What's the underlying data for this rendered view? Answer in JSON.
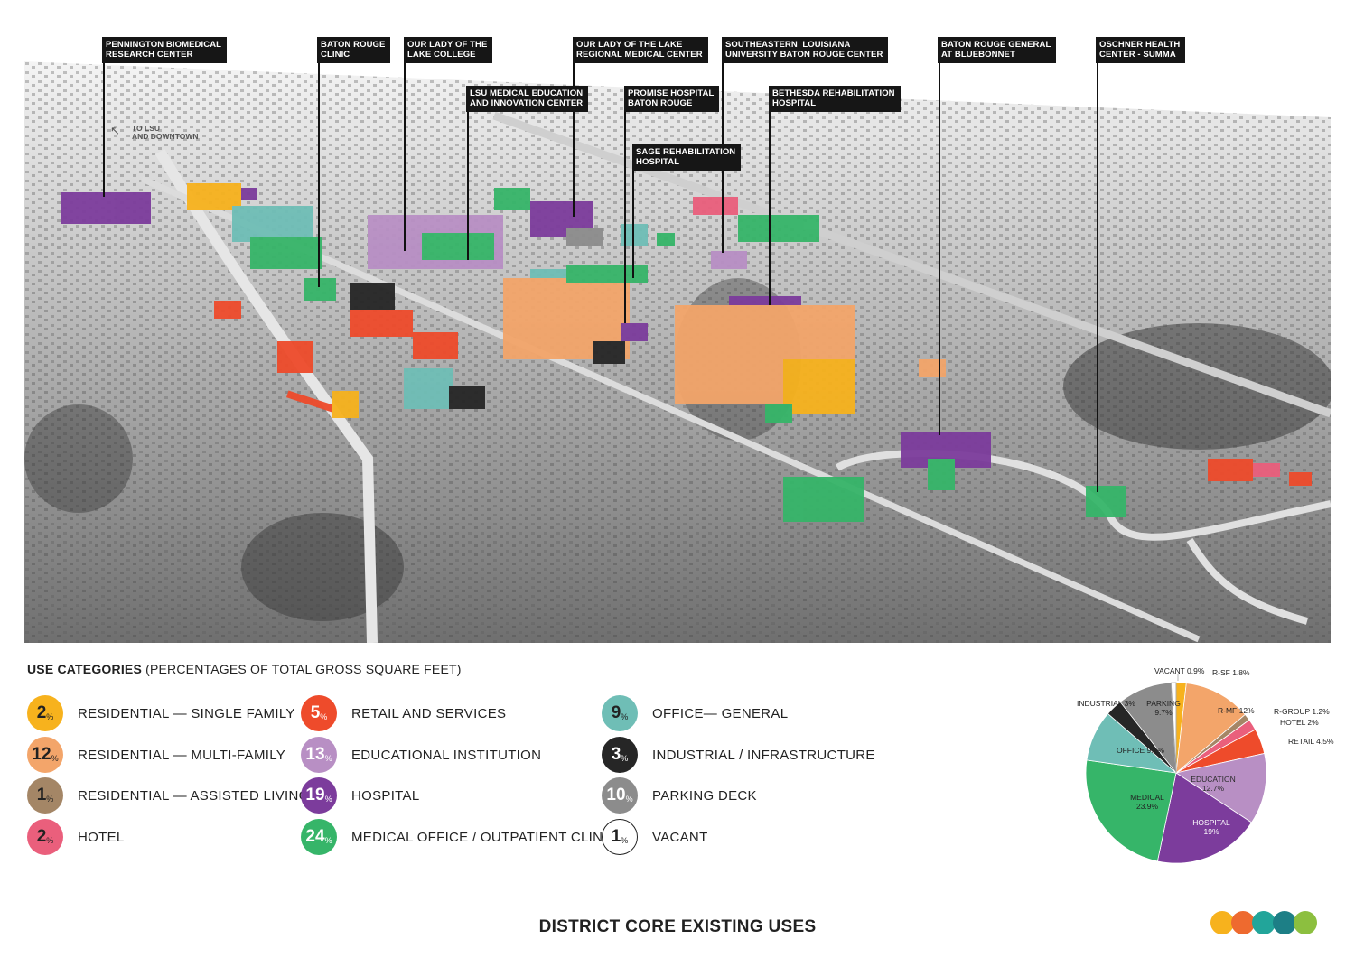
{
  "title": "DISTRICT CORE EXISTING USES",
  "map": {
    "annotation": "TO LSU\nAND DOWNTOWN",
    "callouts": [
      {
        "text": "PENNINGTON BIOMEDICAL\nRESEARCH CENTER"
      },
      {
        "text": "BATON ROUGE\nCLINIC"
      },
      {
        "text": "OUR LADY OF THE\nLAKE COLLEGE"
      },
      {
        "text": "LSU MEDICAL EDUCATION\nAND INNOVATION CENTER"
      },
      {
        "text": "OUR LADY OF THE LAKE\nREGIONAL MEDICAL CENTER"
      },
      {
        "text": "PROMISE HOSPITAL\nBATON ROUGE"
      },
      {
        "text": "SAGE REHABILITATION\nHOSPITAL"
      },
      {
        "text": "SOUTHEASTERN  LOUISIANA\nUNIVERSITY BATON ROUGE CENTER"
      },
      {
        "text": "BETHESDA REHABILITATION\nHOSPITAL"
      },
      {
        "text": "BATON ROUGE GENERAL\nAT BLUEBONNET"
      },
      {
        "text": "OSCHNER HEALTH\nCENTER - SUMMA"
      }
    ]
  },
  "legend": {
    "title": "USE CATEGORIES",
    "subtitle": "(PERCENTAGES OF TOTAL GROSS SQUARE FEET)",
    "items": [
      {
        "value": "2",
        "unit": "%",
        "label": "RESIDENTIAL — SINGLE FAMILY",
        "color": "#f7b21d",
        "text_color": "#222222"
      },
      {
        "value": "12",
        "unit": "%",
        "label": "RESIDENTIAL — MULTI-FAMILY",
        "color": "#f3a56a",
        "text_color": "#222222"
      },
      {
        "value": "1",
        "unit": "%",
        "label": "RESIDENTIAL — ASSISTED LIVING",
        "color": "#a48666",
        "text_color": "#222222"
      },
      {
        "value": "2",
        "unit": "%",
        "label": "HOTEL",
        "color": "#ea5f7c",
        "text_color": "#222222"
      },
      {
        "value": "5",
        "unit": "%",
        "label": "RETAIL AND SERVICES",
        "color": "#ee4b2b",
        "text_color": "#ffffff"
      },
      {
        "value": "13",
        "unit": "%",
        "label": "EDUCATIONAL INSTITUTION",
        "color": "#b88fc4",
        "text_color": "#ffffff"
      },
      {
        "value": "19",
        "unit": "%",
        "label": "HOSPITAL",
        "color": "#7c3c9c",
        "text_color": "#ffffff"
      },
      {
        "value": "24",
        "unit": "%",
        "label": "MEDICAL OFFICE  /  OUTPATIENT CLINIC",
        "color": "#36b569",
        "text_color": "#ffffff"
      },
      {
        "value": "9",
        "unit": "%",
        "label": "OFFICE— GENERAL",
        "color": "#6fbeb6",
        "text_color": "#222222"
      },
      {
        "value": "3",
        "unit": "%",
        "label": "INDUSTRIAL  /  INFRASTRUCTURE",
        "color": "#262626",
        "text_color": "#ffffff"
      },
      {
        "value": "10",
        "unit": "%",
        "label": "PARKING DECK",
        "color": "#8c8c8c",
        "text_color": "#ffffff"
      },
      {
        "value": "1",
        "unit": "%",
        "label": "VACANT",
        "color": "#ffffff",
        "text_color": "#222222"
      }
    ]
  },
  "chart_data": {
    "type": "pie",
    "title": "",
    "slices": [
      {
        "label": "R-SF",
        "value": 1.8,
        "display": "R-SF 1.8%",
        "color": "#f7b21d"
      },
      {
        "label": "R-MF",
        "value": 12,
        "display": "R-MF 12%",
        "color": "#f3a56a"
      },
      {
        "label": "R-GROUP",
        "value": 1.2,
        "display": "R-GROUP 1.2%",
        "color": "#a48666"
      },
      {
        "label": "HOTEL",
        "value": 2,
        "display": "HOTEL 2%",
        "color": "#ea5f7c"
      },
      {
        "label": "RETAIL",
        "value": 4.5,
        "display": "RETAIL 4.5%",
        "color": "#ee4b2b"
      },
      {
        "label": "EDUCATION",
        "value": 12.7,
        "display": "EDUCATION\n12.7%",
        "color": "#b88fc4"
      },
      {
        "label": "HOSPITAL",
        "value": 19,
        "display": "HOSPITAL\n19%",
        "color": "#7c3c9c"
      },
      {
        "label": "MEDICAL",
        "value": 23.9,
        "display": "MEDICAL\n23.9%",
        "color": "#36b569"
      },
      {
        "label": "OFFICE",
        "value": 9.1,
        "display": "OFFICE 9.1%",
        "color": "#6fbeb6"
      },
      {
        "label": "INDUSTRIAL",
        "value": 3,
        "display": "INDUSTRIAL 3%",
        "color": "#262626"
      },
      {
        "label": "PARKING",
        "value": 9.7,
        "display": "PARKING\n9.7%",
        "color": "#8c8c8c"
      },
      {
        "label": "VACANT",
        "value": 0.9,
        "display": "VACANT 0.9%",
        "color": "#ffffff"
      }
    ]
  },
  "brand_dots": [
    "#f7b21d",
    "#ee6a2f",
    "#22a59a",
    "#1d7f86",
    "#8cbf3f"
  ]
}
